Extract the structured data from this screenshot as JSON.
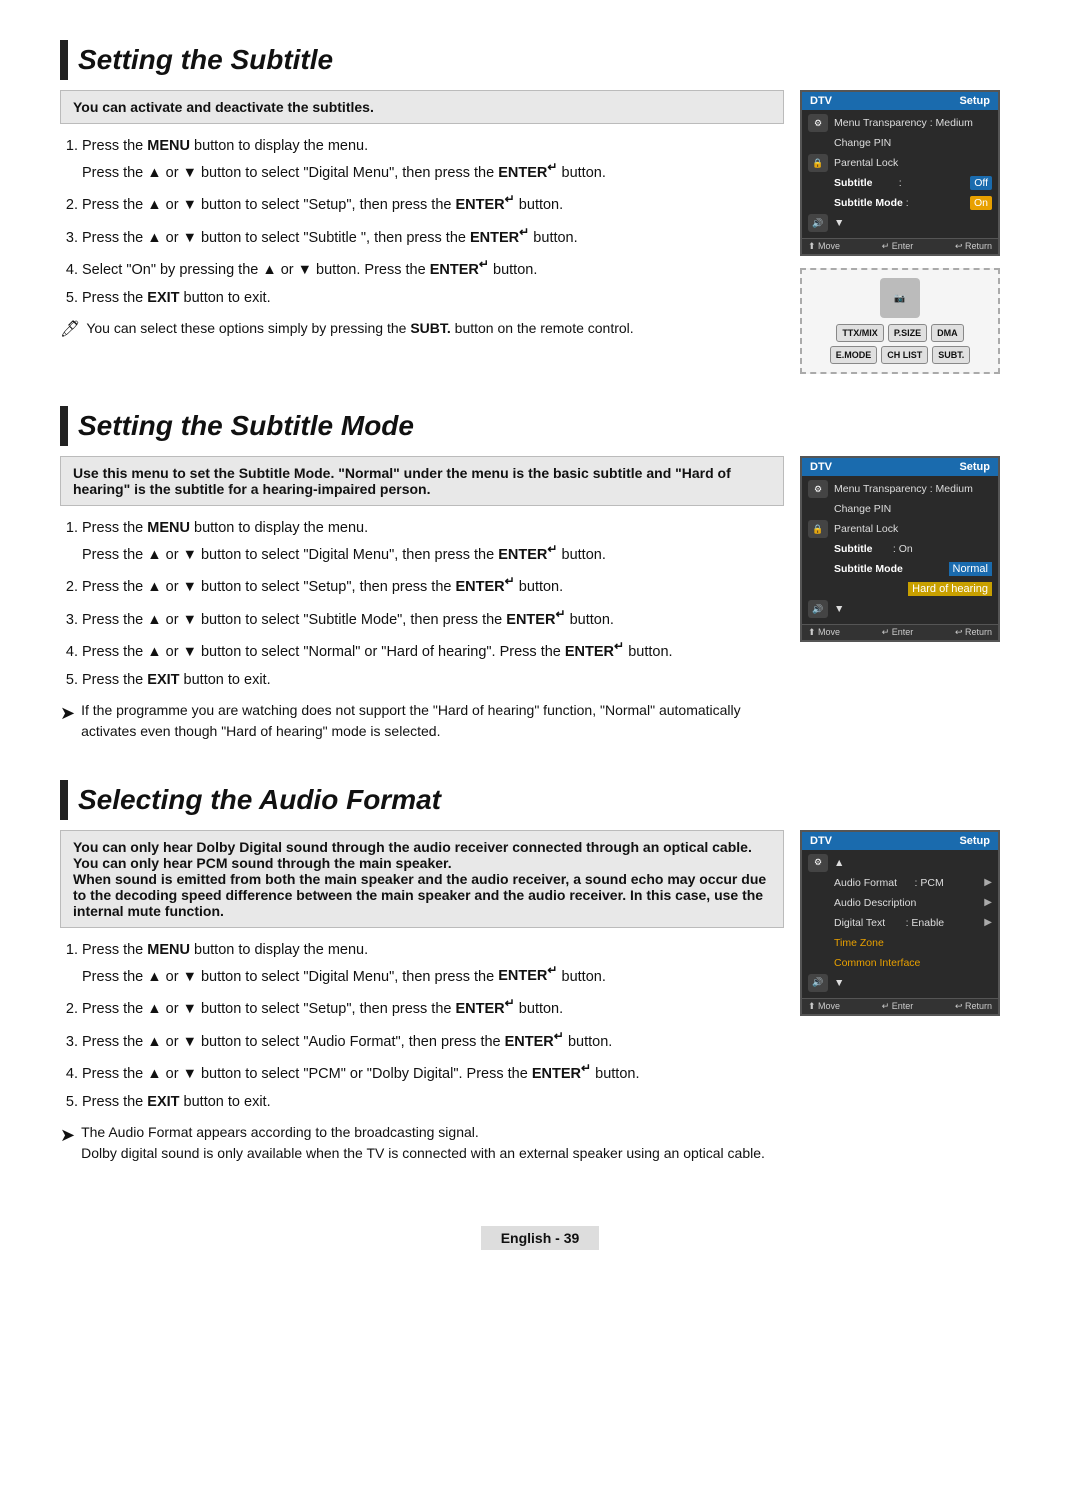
{
  "page": {
    "bottom_label": "English - 39"
  },
  "section1": {
    "title": "Setting the Subtitle",
    "info": "You can activate and deactivate the subtitles.",
    "steps": [
      {
        "id": 1,
        "text": "Press the ",
        "bold1": "MENU",
        "mid1": " button to display the menu.",
        "line2_pre": "Press the ▲ or ▼ button to select \"Digital Menu\", then press the ",
        "bold2": "ENTER",
        "enter_sym": "↵",
        "line2_post": " button."
      },
      {
        "id": 2,
        "text": "Press the ▲ or ▼ button to select \"Setup\", then press the ",
        "bold": "ENTER",
        "enter_sym": "↵",
        "post": " button."
      },
      {
        "id": 3,
        "text": "Press the ▲ or ▼ button to select \"Subtitle \", then press the ",
        "bold": "ENTER",
        "enter_sym": "↵",
        "post": " button."
      },
      {
        "id": 4,
        "text": "Select \"On\" by pressing the ▲ or ▼ button. Press the ",
        "bold": "ENTER",
        "enter_sym": "↵",
        "post": " button."
      },
      {
        "id": 5,
        "text": "Press the ",
        "bold": "EXIT",
        "post": " button to exit."
      }
    ],
    "note1": "You can select these options simply by pressing the ",
    "note1_bold": "SUBT.",
    "note1_post": " button on the remote control.",
    "tv": {
      "header_left": "DTV",
      "header_right": "Setup",
      "rows": [
        {
          "icon": "⚙",
          "text": "Menu Transparency : Medium",
          "value": ""
        },
        {
          "icon": "",
          "text": "Change PIN",
          "value": ""
        },
        {
          "icon": "🔒",
          "text": "Parental Lock",
          "value": ""
        },
        {
          "icon": "",
          "text": "Subtitle",
          "value": ": Off",
          "highlight": "Off"
        },
        {
          "icon": "",
          "text": "Subtitle Mode",
          "value": ": On",
          "highlight": "On"
        },
        {
          "icon": "🔊",
          "text": "▼",
          "value": ""
        }
      ],
      "footer": [
        "⬆ Move",
        "↵ Enter",
        "↩ Return"
      ]
    },
    "remote": {
      "top_buttons": [
        "TTX/MIX",
        "P.SIZE",
        "DMA"
      ],
      "bottom_buttons": [
        "E.MODE",
        "CH LIST",
        "SUBT."
      ]
    }
  },
  "section2": {
    "title": "Setting the Subtitle Mode",
    "info": "Use this menu to set the Subtitle Mode. \"Normal\" under the menu is the basic subtitle and \"Hard of hearing\" is the subtitle for a hearing-impaired person.",
    "steps": [
      {
        "id": 1,
        "line1_pre": "Press the ",
        "bold1": "MENU",
        "line1_post": " button to display the menu.",
        "line2_pre": "Press the ▲ or ▼ button to select \"Digital Menu\", then press the ",
        "bold2": "ENTER",
        "enter_sym": "↵",
        "line2_post": " button."
      },
      {
        "id": 2,
        "text": "Press the ▲ or ▼ button to select \"Setup\", then press the ",
        "bold": "ENTER",
        "enter_sym": "↵",
        "post": " button."
      },
      {
        "id": 3,
        "text": "Press the ▲ or ▼ button to select \"Subtitle Mode\", then press the ",
        "bold": "ENTER",
        "enter_sym": "↵",
        "post": " button."
      },
      {
        "id": 4,
        "text": "Press the ▲ or ▼ button to select \"Normal\" or \"Hard of hearing\". Press the ",
        "bold": "ENTER",
        "enter_sym": "↵",
        "post": " button."
      },
      {
        "id": 5,
        "text": "Press the ",
        "bold": "EXIT",
        "post": " button to exit."
      }
    ],
    "note1": "If the programme you are watching does not support the \"Hard of hearing\" function, \"Normal\" automatically activates even though \"Hard of hearing\" mode is selected.",
    "tv": {
      "header_left": "DTV",
      "header_right": "Setup",
      "rows": [
        {
          "icon": "⚙",
          "text": "Menu Transparency : Medium"
        },
        {
          "icon": "",
          "text": "Change PIN"
        },
        {
          "icon": "🔒",
          "text": "Parental Lock"
        },
        {
          "icon": "",
          "text": "Subtitle          : On"
        },
        {
          "icon": "",
          "text": "Subtitle Mode",
          "value": "Normal",
          "highlight": "normal"
        },
        {
          "icon": "",
          "text": "",
          "value": "Hard of hearing",
          "highlight": "hard"
        },
        {
          "icon": "🔊",
          "text": "▼"
        }
      ],
      "footer": [
        "⬆ Move",
        "↵ Enter",
        "↩ Return"
      ]
    }
  },
  "section3": {
    "title": "Selecting the Audio Format",
    "info": "You can only hear Dolby Digital sound through the audio receiver connected through an optical cable. You can only hear PCM sound through the main speaker.\nWhen sound is emitted from both the main speaker and the audio receiver, a sound echo may occur due to the decoding speed difference between the main speaker and the audio receiver. In this case, use the internal mute function.",
    "steps": [
      {
        "id": 1,
        "line1_pre": "Press the ",
        "bold1": "MENU",
        "line1_post": " button to display the menu.",
        "line2_pre": "Press the ▲ or ▼ button to select \"Digital Menu\", then press the ",
        "bold2": "ENTER",
        "enter_sym": "↵",
        "line2_post": " button."
      },
      {
        "id": 2,
        "text": "Press the ▲ or ▼ button to select \"Setup\", then press the ",
        "bold": "ENTER",
        "enter_sym": "↵",
        "post": " button."
      },
      {
        "id": 3,
        "text": "Press the ▲ or ▼ button to select \"Audio Format\", then press the ",
        "bold": "ENTER",
        "enter_sym": "↵",
        "post": " button."
      },
      {
        "id": 4,
        "text": "Press the ▲ or ▼ button to select \"PCM\" or \"Dolby Digital\". Press the ",
        "bold": "ENTER",
        "enter_sym": "↵",
        "post": " button."
      },
      {
        "id": 5,
        "text": "Press the ",
        "bold": "EXIT",
        "post": " button to exit."
      }
    ],
    "note1": "The Audio Format appears according to the broadcasting signal.",
    "note2_pre": "Dolby digital sound is only available when the TV is connected with an external speaker using an optical cable.",
    "tv": {
      "header_left": "DTV",
      "header_right": "Setup",
      "rows": [
        {
          "icon": "⚙",
          "text": "▲"
        },
        {
          "icon": "",
          "text": "Audio Format      : PCM",
          "arrow": "▶"
        },
        {
          "icon": "",
          "text": "Audio Description",
          "arrow": "▶"
        },
        {
          "icon": "",
          "text": "Digital Text      : Enable",
          "arrow": "▶"
        },
        {
          "icon": "",
          "text": "Time Zone"
        },
        {
          "icon": "",
          "text": "Common Interface"
        },
        {
          "icon": "🔊",
          "text": "▼"
        }
      ],
      "footer": [
        "⬆ Move",
        "↵ Enter",
        "↩ Return"
      ]
    }
  }
}
